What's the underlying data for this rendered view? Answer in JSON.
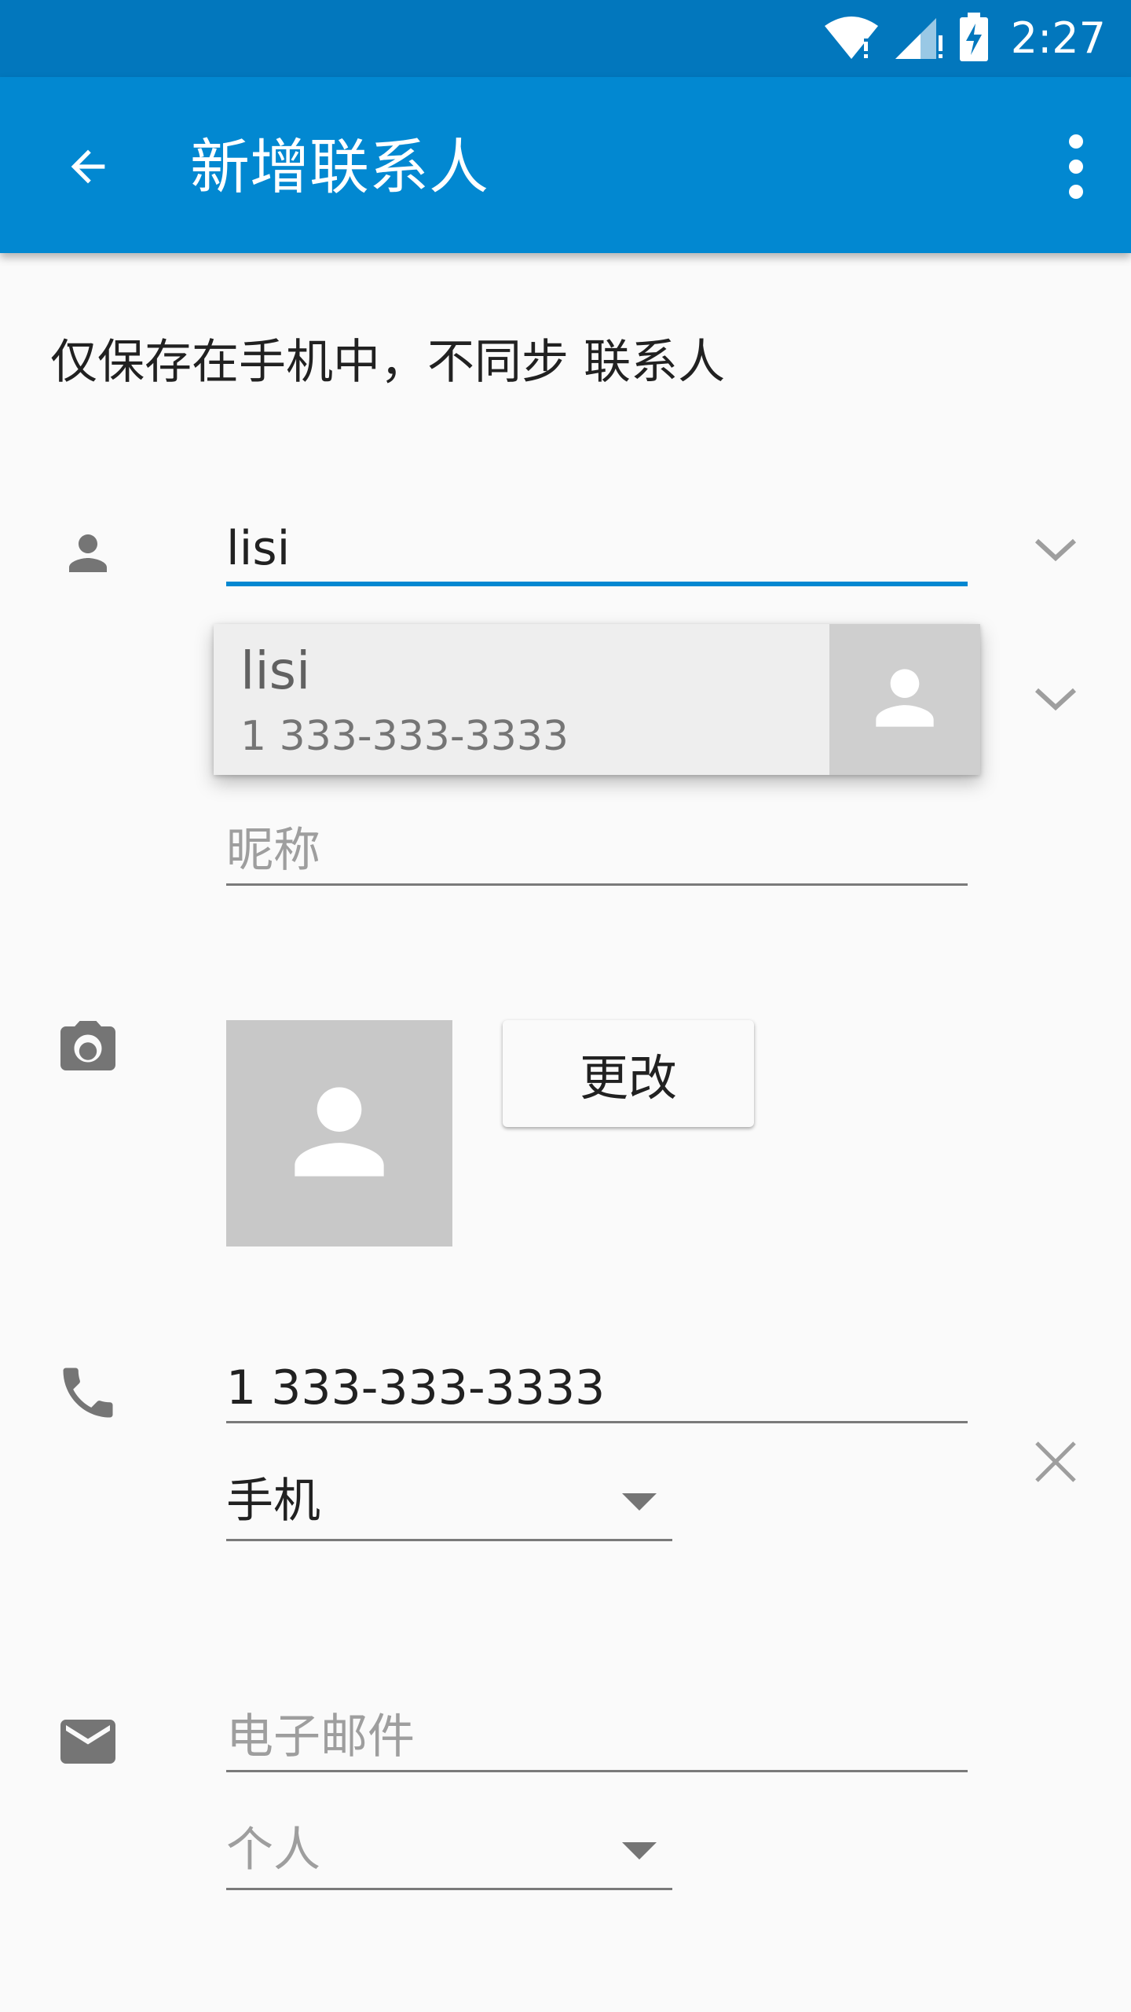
{
  "status_bar": {
    "time": "2:27"
  },
  "app_bar": {
    "title": "新增联系人",
    "back_icon": "arrow-back-icon",
    "menu_icon": "more-vert-icon"
  },
  "info": {
    "text": "仅保存在手机中，不同步 联系人"
  },
  "name_field": {
    "value": "lisi"
  },
  "autocomplete": {
    "name": "lisi",
    "number": "1 333-333-3333"
  },
  "nickname_field": {
    "placeholder": "昵称"
  },
  "photo": {
    "change_label": "更改"
  },
  "phone_field": {
    "value": "1 333-333-3333"
  },
  "phone_type": {
    "value": "手机"
  },
  "email_field": {
    "placeholder": "电子邮件"
  },
  "email_type": {
    "value": "个人"
  },
  "colors": {
    "status_bar": "#0277bd",
    "app_bar": "#0288d1",
    "accent": "#0288d1",
    "background": "#fafafa"
  }
}
